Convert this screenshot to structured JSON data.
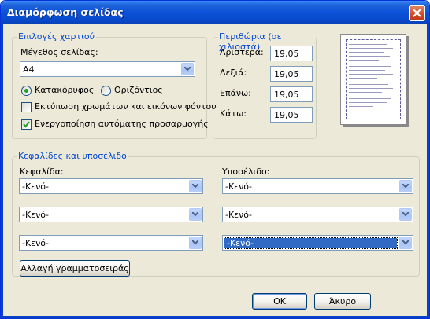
{
  "window": {
    "title": "Διαμόρφωση σελίδας"
  },
  "paper": {
    "group_title": "Επιλογές χαρτιού",
    "size_label": "Μέγεθος σελίδας:",
    "size_value": "A4",
    "orientation": {
      "portrait_label": "Κατακόρυφος",
      "landscape_label": "Οριζόντιος",
      "selected": "portrait"
    },
    "print_background_label": "Εκτύπωση χρωμάτων και εικόνων φόντου",
    "print_background_checked": false,
    "shrink_to_fit_label": "Ενεργοποίηση αυτόματης προσαρμογής",
    "shrink_to_fit_checked": true
  },
  "margins": {
    "group_title": "Περιθώρια (σε χιλιοστά)",
    "left_label": "Αριστερά:",
    "left_value": "19,05",
    "right_label": "Δεξιά:",
    "right_value": "19,05",
    "top_label": "Επάνω:",
    "top_value": "19,05",
    "bottom_label": "Κάτω:",
    "bottom_value": "19,05"
  },
  "headers_footers": {
    "group_title": "Κεφαλίδες και υποσέλιδο",
    "header_label": "Κεφαλίδα:",
    "footer_label": "Υποσέλιδο:",
    "header_values": [
      "-Κενό-",
      "-Κενό-",
      "-Κενό-"
    ],
    "footer_values": [
      "-Κενό-",
      "-Κενό-",
      "-Κενό-"
    ],
    "change_font_label": "Αλλαγή γραμματοσειράς"
  },
  "buttons": {
    "ok_label": "OK",
    "cancel_label": "Άκυρο"
  },
  "colors": {
    "title_bar": "#0a52d8",
    "group_title": "#0046d5",
    "dialog_bg": "#ece9d8",
    "selection": "#316ac5"
  }
}
